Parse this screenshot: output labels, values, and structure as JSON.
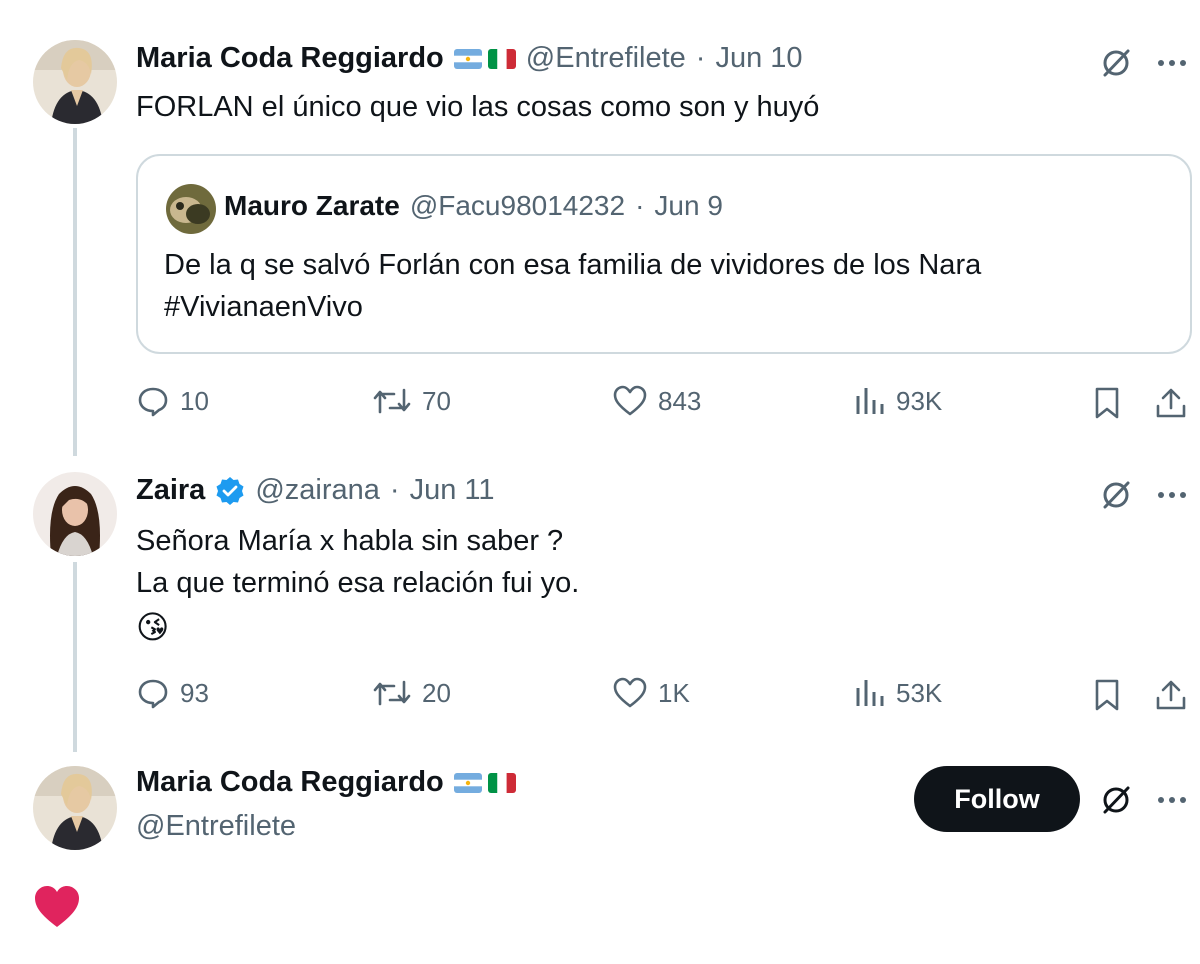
{
  "tweet1": {
    "author": "Maria Coda Reggiardo",
    "handle": "@Entrefilete",
    "sep": "·",
    "date": "Jun 10",
    "text": "FORLAN el único que vio las cosas como son y huyó",
    "quote": {
      "author": "Mauro Zarate",
      "handle": "@Facu98014232",
      "sep": "·",
      "date": "Jun 9",
      "line1": "De la q se salvó Forlán con esa familia de vividores de los Nara",
      "line2": "#VivianaenVivo"
    },
    "actions": {
      "replies": "10",
      "reposts": "70",
      "likes": "843",
      "views": "93K"
    }
  },
  "tweet2": {
    "author": "Zaira",
    "handle": "@zairana",
    "sep": "·",
    "date": "Jun 11",
    "line1": "Señora María x habla sin saber ?",
    "line2": "La que terminó esa relación fui yo.",
    "emoji": "😘",
    "actions": {
      "replies": "93",
      "reposts": "20",
      "likes": "1K",
      "views": "53K"
    }
  },
  "tweet3": {
    "author": "Maria Coda Reggiardo",
    "handle": "@Entrefilete",
    "follow_label": "Follow"
  },
  "colors": {
    "text": "#0f1419",
    "muted": "#536471",
    "border": "#cfd9de",
    "verified": "#1d9bf0",
    "heart": "#e0245e"
  },
  "icons": [
    "grok-icon",
    "more-icon",
    "reply-icon",
    "repost-icon",
    "like-icon",
    "views-icon",
    "bookmark-icon",
    "share-icon",
    "verified-badge-icon",
    "heart-icon"
  ]
}
